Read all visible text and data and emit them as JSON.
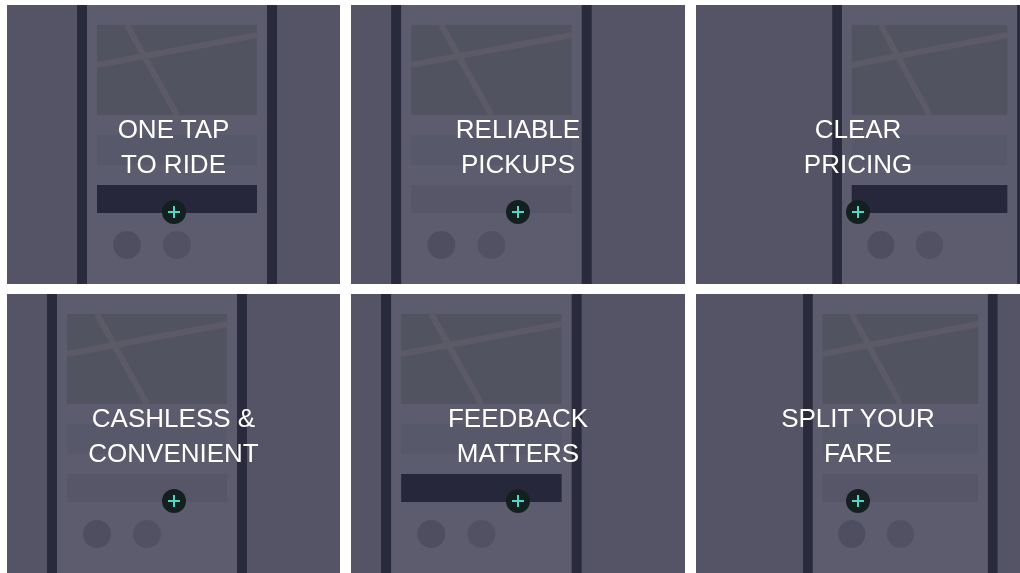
{
  "features": [
    {
      "title_lines": [
        "ONE TAP",
        "TO RIDE"
      ]
    },
    {
      "title_lines": [
        "RELIABLE",
        "PICKUPS"
      ]
    },
    {
      "title_lines": [
        "CLEAR",
        "PRICING"
      ]
    },
    {
      "title_lines": [
        "CASHLESS &",
        "CONVENIENT"
      ]
    },
    {
      "title_lines": [
        "FEEDBACK",
        "MATTERS"
      ]
    },
    {
      "title_lines": [
        "SPLIT YOUR",
        "FARE"
      ]
    }
  ]
}
